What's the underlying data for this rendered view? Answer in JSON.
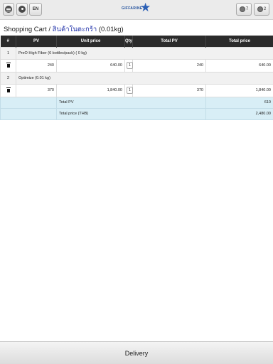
{
  "header": {
    "lang_label": "EN",
    "logo_text": "GIFFARINE",
    "badge_1_count": "7",
    "badge_2_count": "2",
    "icons": [
      "menu-icon",
      "user-icon",
      "badge-icon"
    ]
  },
  "title": {
    "main": "Shopping Cart / ",
    "thai": "สินค้าในตะกร้า",
    "weight": " (0.01kg)"
  },
  "table": {
    "columns": [
      "#",
      "PV",
      "Unit price",
      "Qty",
      "Total PV",
      "Total price"
    ],
    "items": [
      {
        "index": "1",
        "name": "PreO High Fiber   (6 bottles/pack)  ( 0 kg)",
        "pv": "240",
        "unit_price": "640.00",
        "qty": "1",
        "total_pv": "240",
        "total_price": "640.00"
      },
      {
        "index": "2",
        "name": "Optimize  (0.01 kg)",
        "pv": "370",
        "unit_price": "1,840.00",
        "qty": "1",
        "total_pv": "370",
        "total_price": "1,840.00"
      }
    ],
    "summary": [
      {
        "label": "Total PV",
        "value": "610"
      },
      {
        "label": "Total price (THB)",
        "value": "2,480.00"
      }
    ]
  },
  "footer": {
    "delivery_label": "Delivery"
  },
  "colors": {
    "header_bg": "#2b2b2b",
    "summary_bg": "#d8eef6",
    "thai_link": "#2233aa"
  }
}
